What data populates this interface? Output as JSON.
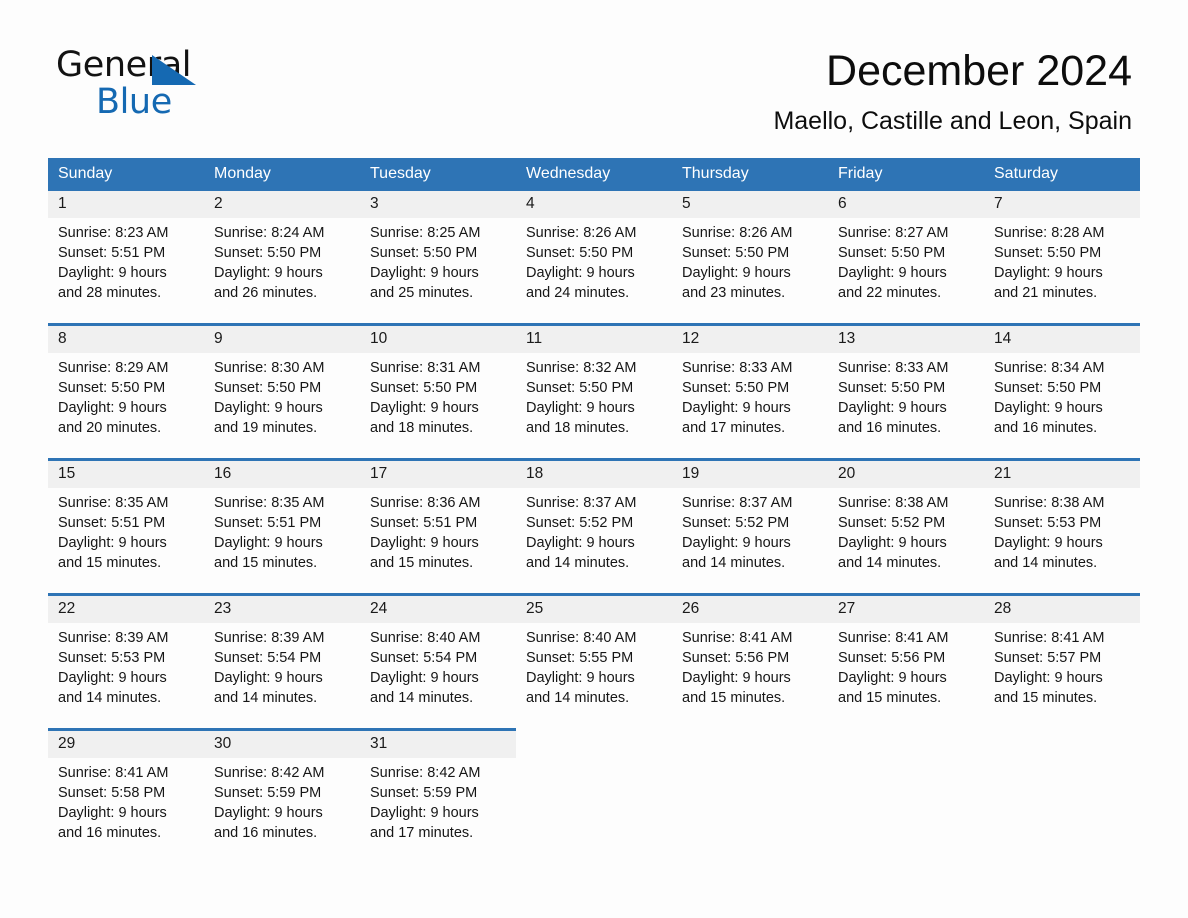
{
  "brand": {
    "name_part1": "General",
    "name_part2": "Blue",
    "triangle_color": "#1569b2"
  },
  "header": {
    "title": "December 2024",
    "subtitle": "Maello, Castille and Leon, Spain"
  },
  "colors": {
    "header_blue": "#2e74b5",
    "daynum_band": "#f0f0f0",
    "page_background": "#fdfdfd",
    "text": "#161616"
  },
  "weekday_headers": [
    "Sunday",
    "Monday",
    "Tuesday",
    "Wednesday",
    "Thursday",
    "Friday",
    "Saturday"
  ],
  "weeks": [
    {
      "days": [
        {
          "num": "1",
          "sunrise": "Sunrise: 8:23 AM",
          "sunset": "Sunset: 5:51 PM",
          "daylight1": "Daylight: 9 hours",
          "daylight2": "and 28 minutes."
        },
        {
          "num": "2",
          "sunrise": "Sunrise: 8:24 AM",
          "sunset": "Sunset: 5:50 PM",
          "daylight1": "Daylight: 9 hours",
          "daylight2": "and 26 minutes."
        },
        {
          "num": "3",
          "sunrise": "Sunrise: 8:25 AM",
          "sunset": "Sunset: 5:50 PM",
          "daylight1": "Daylight: 9 hours",
          "daylight2": "and 25 minutes."
        },
        {
          "num": "4",
          "sunrise": "Sunrise: 8:26 AM",
          "sunset": "Sunset: 5:50 PM",
          "daylight1": "Daylight: 9 hours",
          "daylight2": "and 24 minutes."
        },
        {
          "num": "5",
          "sunrise": "Sunrise: 8:26 AM",
          "sunset": "Sunset: 5:50 PM",
          "daylight1": "Daylight: 9 hours",
          "daylight2": "and 23 minutes."
        },
        {
          "num": "6",
          "sunrise": "Sunrise: 8:27 AM",
          "sunset": "Sunset: 5:50 PM",
          "daylight1": "Daylight: 9 hours",
          "daylight2": "and 22 minutes."
        },
        {
          "num": "7",
          "sunrise": "Sunrise: 8:28 AM",
          "sunset": "Sunset: 5:50 PM",
          "daylight1": "Daylight: 9 hours",
          "daylight2": "and 21 minutes."
        }
      ]
    },
    {
      "days": [
        {
          "num": "8",
          "sunrise": "Sunrise: 8:29 AM",
          "sunset": "Sunset: 5:50 PM",
          "daylight1": "Daylight: 9 hours",
          "daylight2": "and 20 minutes."
        },
        {
          "num": "9",
          "sunrise": "Sunrise: 8:30 AM",
          "sunset": "Sunset: 5:50 PM",
          "daylight1": "Daylight: 9 hours",
          "daylight2": "and 19 minutes."
        },
        {
          "num": "10",
          "sunrise": "Sunrise: 8:31 AM",
          "sunset": "Sunset: 5:50 PM",
          "daylight1": "Daylight: 9 hours",
          "daylight2": "and 18 minutes."
        },
        {
          "num": "11",
          "sunrise": "Sunrise: 8:32 AM",
          "sunset": "Sunset: 5:50 PM",
          "daylight1": "Daylight: 9 hours",
          "daylight2": "and 18 minutes."
        },
        {
          "num": "12",
          "sunrise": "Sunrise: 8:33 AM",
          "sunset": "Sunset: 5:50 PM",
          "daylight1": "Daylight: 9 hours",
          "daylight2": "and 17 minutes."
        },
        {
          "num": "13",
          "sunrise": "Sunrise: 8:33 AM",
          "sunset": "Sunset: 5:50 PM",
          "daylight1": "Daylight: 9 hours",
          "daylight2": "and 16 minutes."
        },
        {
          "num": "14",
          "sunrise": "Sunrise: 8:34 AM",
          "sunset": "Sunset: 5:50 PM",
          "daylight1": "Daylight: 9 hours",
          "daylight2": "and 16 minutes."
        }
      ]
    },
    {
      "days": [
        {
          "num": "15",
          "sunrise": "Sunrise: 8:35 AM",
          "sunset": "Sunset: 5:51 PM",
          "daylight1": "Daylight: 9 hours",
          "daylight2": "and 15 minutes."
        },
        {
          "num": "16",
          "sunrise": "Sunrise: 8:35 AM",
          "sunset": "Sunset: 5:51 PM",
          "daylight1": "Daylight: 9 hours",
          "daylight2": "and 15 minutes."
        },
        {
          "num": "17",
          "sunrise": "Sunrise: 8:36 AM",
          "sunset": "Sunset: 5:51 PM",
          "daylight1": "Daylight: 9 hours",
          "daylight2": "and 15 minutes."
        },
        {
          "num": "18",
          "sunrise": "Sunrise: 8:37 AM",
          "sunset": "Sunset: 5:52 PM",
          "daylight1": "Daylight: 9 hours",
          "daylight2": "and 14 minutes."
        },
        {
          "num": "19",
          "sunrise": "Sunrise: 8:37 AM",
          "sunset": "Sunset: 5:52 PM",
          "daylight1": "Daylight: 9 hours",
          "daylight2": "and 14 minutes."
        },
        {
          "num": "20",
          "sunrise": "Sunrise: 8:38 AM",
          "sunset": "Sunset: 5:52 PM",
          "daylight1": "Daylight: 9 hours",
          "daylight2": "and 14 minutes."
        },
        {
          "num": "21",
          "sunrise": "Sunrise: 8:38 AM",
          "sunset": "Sunset: 5:53 PM",
          "daylight1": "Daylight: 9 hours",
          "daylight2": "and 14 minutes."
        }
      ]
    },
    {
      "days": [
        {
          "num": "22",
          "sunrise": "Sunrise: 8:39 AM",
          "sunset": "Sunset: 5:53 PM",
          "daylight1": "Daylight: 9 hours",
          "daylight2": "and 14 minutes."
        },
        {
          "num": "23",
          "sunrise": "Sunrise: 8:39 AM",
          "sunset": "Sunset: 5:54 PM",
          "daylight1": "Daylight: 9 hours",
          "daylight2": "and 14 minutes."
        },
        {
          "num": "24",
          "sunrise": "Sunrise: 8:40 AM",
          "sunset": "Sunset: 5:54 PM",
          "daylight1": "Daylight: 9 hours",
          "daylight2": "and 14 minutes."
        },
        {
          "num": "25",
          "sunrise": "Sunrise: 8:40 AM",
          "sunset": "Sunset: 5:55 PM",
          "daylight1": "Daylight: 9 hours",
          "daylight2": "and 14 minutes."
        },
        {
          "num": "26",
          "sunrise": "Sunrise: 8:41 AM",
          "sunset": "Sunset: 5:56 PM",
          "daylight1": "Daylight: 9 hours",
          "daylight2": "and 15 minutes."
        },
        {
          "num": "27",
          "sunrise": "Sunrise: 8:41 AM",
          "sunset": "Sunset: 5:56 PM",
          "daylight1": "Daylight: 9 hours",
          "daylight2": "and 15 minutes."
        },
        {
          "num": "28",
          "sunrise": "Sunrise: 8:41 AM",
          "sunset": "Sunset: 5:57 PM",
          "daylight1": "Daylight: 9 hours",
          "daylight2": "and 15 minutes."
        }
      ]
    },
    {
      "days": [
        {
          "num": "29",
          "sunrise": "Sunrise: 8:41 AM",
          "sunset": "Sunset: 5:58 PM",
          "daylight1": "Daylight: 9 hours",
          "daylight2": "and 16 minutes."
        },
        {
          "num": "30",
          "sunrise": "Sunrise: 8:42 AM",
          "sunset": "Sunset: 5:59 PM",
          "daylight1": "Daylight: 9 hours",
          "daylight2": "and 16 minutes."
        },
        {
          "num": "31",
          "sunrise": "Sunrise: 8:42 AM",
          "sunset": "Sunset: 5:59 PM",
          "daylight1": "Daylight: 9 hours",
          "daylight2": "and 17 minutes."
        },
        {
          "num": "",
          "sunrise": "",
          "sunset": "",
          "daylight1": "",
          "daylight2": ""
        },
        {
          "num": "",
          "sunrise": "",
          "sunset": "",
          "daylight1": "",
          "daylight2": ""
        },
        {
          "num": "",
          "sunrise": "",
          "sunset": "",
          "daylight1": "",
          "daylight2": ""
        },
        {
          "num": "",
          "sunrise": "",
          "sunset": "",
          "daylight1": "",
          "daylight2": ""
        }
      ]
    }
  ]
}
